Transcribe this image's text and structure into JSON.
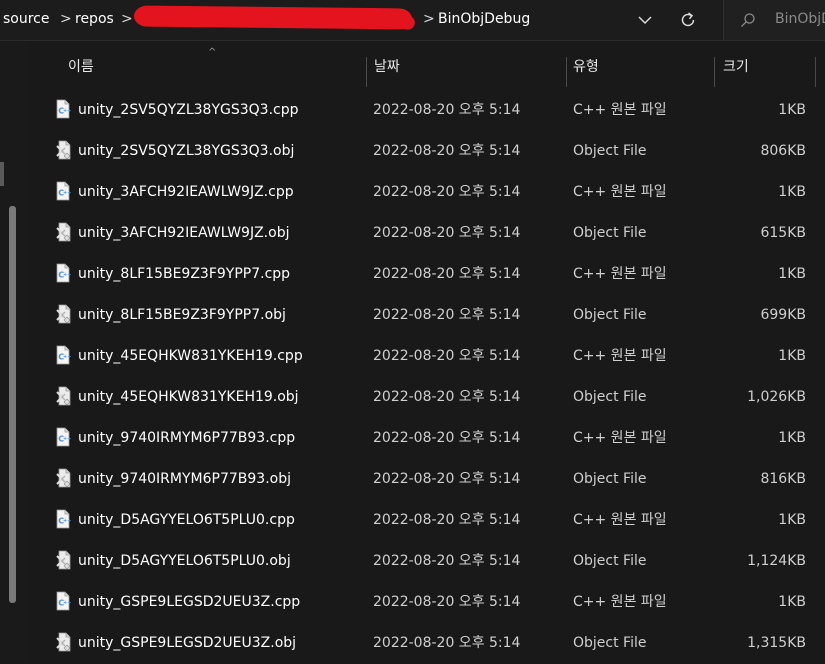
{
  "breadcrumb": {
    "items": [
      "source",
      "repos",
      "BinObjDebug"
    ],
    "separator": ">"
  },
  "toolbar": {
    "dropdown_icon": "chevron-down-icon",
    "refresh_icon": "refresh-icon"
  },
  "search": {
    "placeholder": "BinObjD"
  },
  "columns": {
    "name": "이름",
    "date": "날짜",
    "type": "유형",
    "size": "크기"
  },
  "files": [
    {
      "name": "unity_2SV5QYZL38YGS3Q3.cpp",
      "date": "2022-08-20 오후 5:14",
      "type": "C++ 원본 파일",
      "size": "1KB",
      "icon": "cpp-file-icon"
    },
    {
      "name": "unity_2SV5QYZL38YGS3Q3.obj",
      "date": "2022-08-20 오후 5:14",
      "type": "Object File",
      "size": "806KB",
      "icon": "obj-file-icon"
    },
    {
      "name": "unity_3AFCH92IEAWLW9JZ.cpp",
      "date": "2022-08-20 오후 5:14",
      "type": "C++ 원본 파일",
      "size": "1KB",
      "icon": "cpp-file-icon"
    },
    {
      "name": "unity_3AFCH92IEAWLW9JZ.obj",
      "date": "2022-08-20 오후 5:14",
      "type": "Object File",
      "size": "615KB",
      "icon": "obj-file-icon"
    },
    {
      "name": "unity_8LF15BE9Z3F9YPP7.cpp",
      "date": "2022-08-20 오후 5:14",
      "type": "C++ 원본 파일",
      "size": "1KB",
      "icon": "cpp-file-icon"
    },
    {
      "name": "unity_8LF15BE9Z3F9YPP7.obj",
      "date": "2022-08-20 오후 5:14",
      "type": "Object File",
      "size": "699KB",
      "icon": "obj-file-icon"
    },
    {
      "name": "unity_45EQHKW831YKEH19.cpp",
      "date": "2022-08-20 오후 5:14",
      "type": "C++ 원본 파일",
      "size": "1KB",
      "icon": "cpp-file-icon"
    },
    {
      "name": "unity_45EQHKW831YKEH19.obj",
      "date": "2022-08-20 오후 5:14",
      "type": "Object File",
      "size": "1,026KB",
      "icon": "obj-file-icon"
    },
    {
      "name": "unity_9740IRMYM6P77B93.cpp",
      "date": "2022-08-20 오후 5:14",
      "type": "C++ 원본 파일",
      "size": "1KB",
      "icon": "cpp-file-icon"
    },
    {
      "name": "unity_9740IRMYM6P77B93.obj",
      "date": "2022-08-20 오후 5:14",
      "type": "Object File",
      "size": "816KB",
      "icon": "obj-file-icon"
    },
    {
      "name": "unity_D5AGYYELO6T5PLU0.cpp",
      "date": "2022-08-20 오후 5:14",
      "type": "C++ 원본 파일",
      "size": "1KB",
      "icon": "cpp-file-icon"
    },
    {
      "name": "unity_D5AGYYELO6T5PLU0.obj",
      "date": "2022-08-20 오후 5:14",
      "type": "Object File",
      "size": "1,124KB",
      "icon": "obj-file-icon"
    },
    {
      "name": "unity_GSPE9LEGSD2UEU3Z.cpp",
      "date": "2022-08-20 오후 5:14",
      "type": "C++ 원본 파일",
      "size": "1KB",
      "icon": "cpp-file-icon"
    },
    {
      "name": "unity_GSPE9LEGSD2UEU3Z.obj",
      "date": "2022-08-20 오후 5:14",
      "type": "Object File",
      "size": "1,315KB",
      "icon": "obj-file-icon"
    }
  ],
  "colors": {
    "background": "#191919",
    "text": "#ffffff",
    "secondary_text": "#cfcfcf",
    "redaction": "#e3141d",
    "cpp_icon_accent": "#4d8fd6"
  }
}
